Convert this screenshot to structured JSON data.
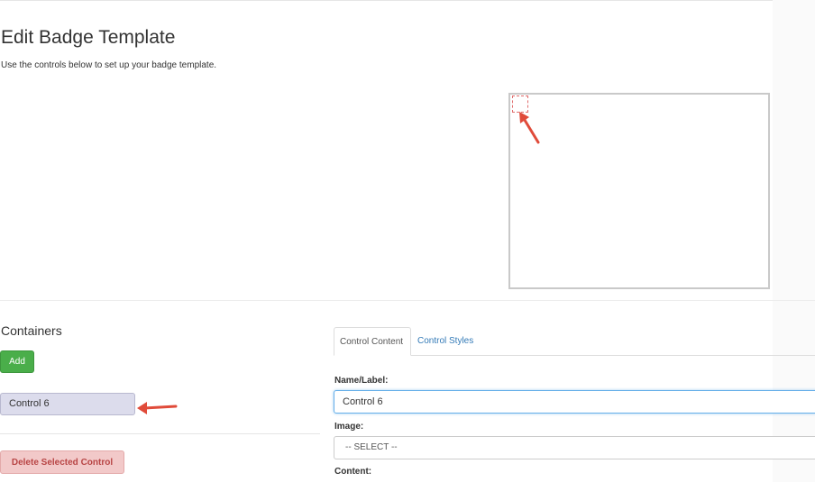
{
  "header": {
    "title": "Edit Badge Template",
    "subtitle": "Use the controls below to set up your badge template."
  },
  "containers": {
    "heading": "Containers",
    "add_label": "Add",
    "items": [
      {
        "label": "Control 6",
        "selected": true
      }
    ],
    "delete_label": "Delete Selected Control"
  },
  "editor": {
    "tabs": [
      {
        "label": "Control Content",
        "active": true
      },
      {
        "label": "Control Styles",
        "active": false
      }
    ],
    "name_label": "Name/Label:",
    "name_value": "Control 6",
    "image_label": "Image:",
    "image_selected": "-- SELECT --",
    "content_label": "Content:"
  },
  "colors": {
    "annotation_arrow": "#e04b3a",
    "add_button": "#4aae4a",
    "delete_button_text": "#b84545",
    "tab_link": "#337ab7",
    "input_focus": "#66afe9"
  }
}
